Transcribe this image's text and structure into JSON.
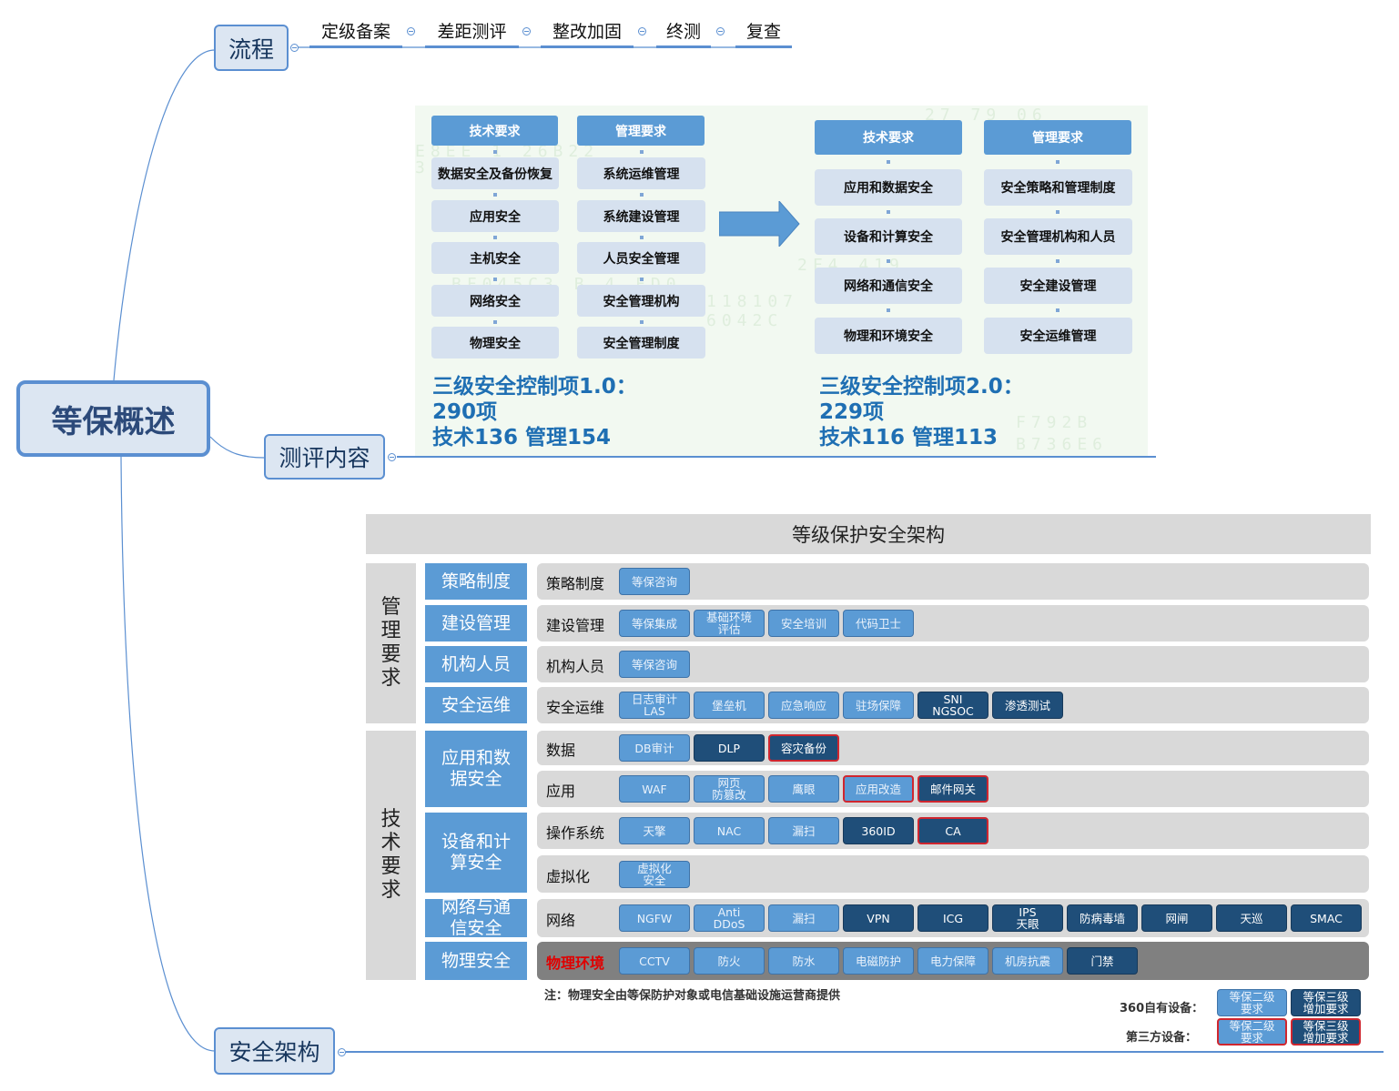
{
  "root": {
    "label": "等保概述"
  },
  "topics": {
    "process": {
      "label": "流程",
      "steps": [
        "定级备案",
        "差距测评",
        "整改加固",
        "终测",
        "复查"
      ]
    },
    "content": {
      "label": "测评内容"
    },
    "architecture": {
      "label": "安全架构"
    }
  },
  "content_image": {
    "v1": {
      "tech_header": "技术要求",
      "mgmt_header": "管理要求",
      "tech_items": [
        "数据安全及备份恢复",
        "应用安全",
        "主机安全",
        "网络安全",
        "物理安全"
      ],
      "mgmt_items": [
        "系统运维管理",
        "系统建设管理",
        "人员安全管理",
        "安全管理机构",
        "安全管理制度"
      ],
      "title": "三级安全控制项1.0：",
      "total": "290项",
      "split": "技术136 管理154"
    },
    "v2": {
      "tech_header": "技术要求",
      "mgmt_header": "管理要求",
      "tech_items": [
        "应用和数据安全",
        "设备和计算安全",
        "网络和通信安全",
        "物理和环境安全"
      ],
      "mgmt_items": [
        "安全策略和管理制度",
        "安全管理机构和人员",
        "安全建设管理",
        "安全运维管理"
      ],
      "title": "三级安全控制项2.0：",
      "total": "229项",
      "split": "技术116 管理113"
    },
    "arrow_icon": "right-arrow-icon"
  },
  "arch_image": {
    "title": "等级保护安全架构",
    "side_mgmt": "管理要求",
    "side_tech": "技术要求",
    "categories": [
      "策略制度",
      "建设管理",
      "机构人员",
      "安全运维",
      "应用和数据安全",
      "设备和计算安全",
      "网络与通信安全",
      "物理安全"
    ],
    "rows": [
      {
        "label": "策略制度",
        "chips": [
          {
            "text": "等保咨询",
            "style": "l"
          }
        ]
      },
      {
        "label": "建设管理",
        "chips": [
          {
            "text": "等保集成",
            "style": "l"
          },
          {
            "text": "基础环境\n评估",
            "style": "l"
          },
          {
            "text": "安全培训",
            "style": "l"
          },
          {
            "text": "代码卫士",
            "style": "l"
          }
        ]
      },
      {
        "label": "机构人员",
        "chips": [
          {
            "text": "等保咨询",
            "style": "l"
          }
        ]
      },
      {
        "label": "安全运维",
        "chips": [
          {
            "text": "日志审计\nLAS",
            "style": "l"
          },
          {
            "text": "堡垒机",
            "style": "l"
          },
          {
            "text": "应急响应",
            "style": "l"
          },
          {
            "text": "驻场保障",
            "style": "l"
          },
          {
            "text": "SNI\nNGSOC",
            "style": "d"
          },
          {
            "text": "渗透测试",
            "style": "d"
          }
        ]
      },
      {
        "label": "数据",
        "chips": [
          {
            "text": "DB审计",
            "style": "l"
          },
          {
            "text": "DLP",
            "style": "d"
          },
          {
            "text": "容灾备份",
            "style": "d red"
          }
        ]
      },
      {
        "label": "应用",
        "chips": [
          {
            "text": "WAF",
            "style": "l"
          },
          {
            "text": "网页\n防篡改",
            "style": "l"
          },
          {
            "text": "鹰眼",
            "style": "l"
          },
          {
            "text": "应用改造",
            "style": "l red"
          },
          {
            "text": "邮件网关",
            "style": "d red"
          }
        ]
      },
      {
        "label": "操作系统",
        "chips": [
          {
            "text": "天擎",
            "style": "l"
          },
          {
            "text": "NAC",
            "style": "l"
          },
          {
            "text": "漏扫",
            "style": "l"
          },
          {
            "text": "360ID",
            "style": "d"
          },
          {
            "text": "CA",
            "style": "d red"
          }
        ]
      },
      {
        "label": "虚拟化",
        "chips": [
          {
            "text": "虚拟化\n安全",
            "style": "l"
          }
        ]
      },
      {
        "label": "网络",
        "chips": [
          {
            "text": "NGFW",
            "style": "l"
          },
          {
            "text": "Anti\nDDoS",
            "style": "l"
          },
          {
            "text": "漏扫",
            "style": "l"
          },
          {
            "text": "VPN",
            "style": "d"
          },
          {
            "text": "ICG",
            "style": "d"
          },
          {
            "text": "IPS\n天眼",
            "style": "d"
          },
          {
            "text": "防病毒墙",
            "style": "d"
          },
          {
            "text": "网闸",
            "style": "d"
          },
          {
            "text": "天巡",
            "style": "d"
          },
          {
            "text": "SMAC",
            "style": "d"
          }
        ]
      },
      {
        "label": "物理环境",
        "chips": [
          {
            "text": "CCTV",
            "style": "l"
          },
          {
            "text": "防火",
            "style": "l"
          },
          {
            "text": "防水",
            "style": "l"
          },
          {
            "text": "电磁防护",
            "style": "l"
          },
          {
            "text": "电力保障",
            "style": "l"
          },
          {
            "text": "机房抗震",
            "style": "l"
          },
          {
            "text": "门禁",
            "style": "d"
          }
        ]
      }
    ],
    "note": "注：物理安全由等保防护对象或电信基础设施运营商提供",
    "legend": {
      "own_label": "360自有设备：",
      "third_label": "第三方设备：",
      "level2": "等保二级\n要求",
      "level3": "等保三级\n增加要求"
    }
  },
  "colors": {
    "accent": "#5b8fd1",
    "node_fill": "#dce6f2",
    "chip_light": "#5b9bd5",
    "chip_dark": "#1f4e79",
    "third_party_border": "#d0262f",
    "count_text": "#1f6fb3"
  }
}
